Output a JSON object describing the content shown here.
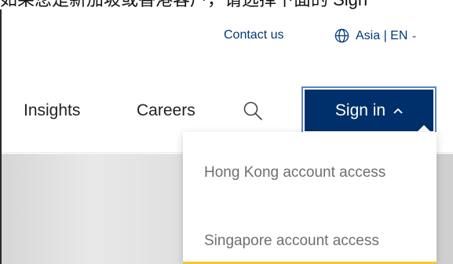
{
  "top_strip": {
    "text": "如果您是新加坡或香港客户，请选择下面的 Sign"
  },
  "utility": {
    "contact_label": "Contact us",
    "region_label": "Asia | EN",
    "globe_icon": "globe-icon",
    "region_chevron": "chevron-down-icon"
  },
  "nav": {
    "items": [
      {
        "label": "Insights"
      },
      {
        "label": "Careers"
      }
    ],
    "search_icon": "search-icon"
  },
  "signin": {
    "label": "Sign in",
    "chevron": "^",
    "expanded": true
  },
  "dropdown": {
    "items": [
      {
        "label": "Hong Kong account access"
      },
      {
        "label": "Singapore account access"
      }
    ]
  },
  "colors": {
    "brand_navy": "#00306b",
    "link_blue": "#003a7a",
    "focus_ring": "#5b86c6",
    "highlight_yellow": "#f2c53d",
    "muted_text": "#6f6f6f"
  }
}
